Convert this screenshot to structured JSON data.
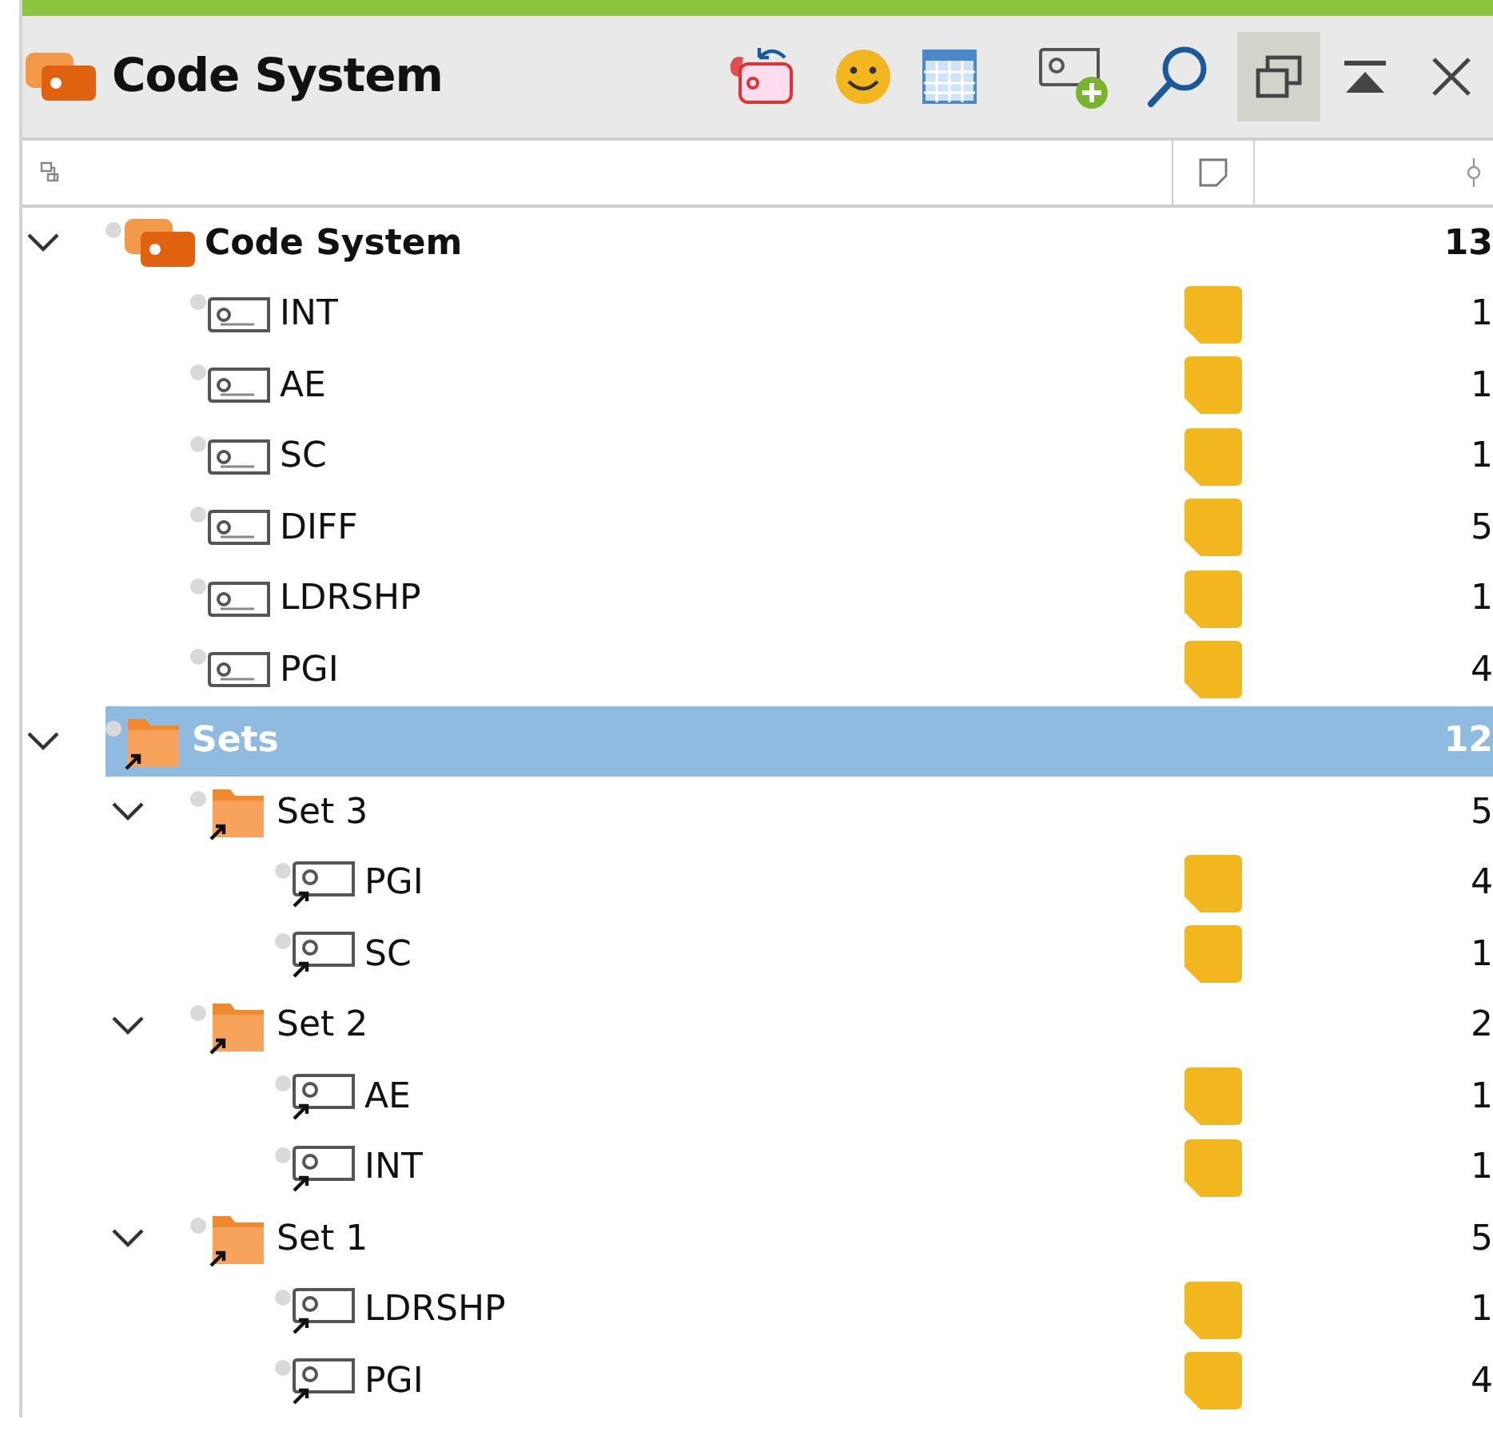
{
  "panel": {
    "title": "Code System"
  },
  "toolbar": [
    {
      "kind": "reset-codes",
      "pressed": false
    },
    {
      "kind": "emoticon",
      "pressed": false
    },
    {
      "kind": "table",
      "pressed": false
    },
    {
      "kind": "new-code",
      "pressed": false
    },
    {
      "kind": "search",
      "pressed": false
    },
    {
      "kind": "undock",
      "pressed": true
    },
    {
      "kind": "collapse",
      "pressed": false
    },
    {
      "kind": "close",
      "pressed": false
    }
  ],
  "tree": [
    {
      "kind": "root",
      "label": "Code System",
      "count": "13",
      "memo": false,
      "selected": false,
      "expanded": true,
      "children": [
        {
          "kind": "code",
          "label": "INT",
          "count": "1",
          "memo": true,
          "selected": false
        },
        {
          "kind": "code",
          "label": "AE",
          "count": "1",
          "memo": true,
          "selected": false
        },
        {
          "kind": "code",
          "label": "SC",
          "count": "1",
          "memo": true,
          "selected": false
        },
        {
          "kind": "code",
          "label": "DIFF",
          "count": "5",
          "memo": true,
          "selected": false
        },
        {
          "kind": "code",
          "label": "LDRSHP",
          "count": "1",
          "memo": true,
          "selected": false
        },
        {
          "kind": "code",
          "label": "PGI",
          "count": "4",
          "memo": true,
          "selected": false
        }
      ]
    },
    {
      "kind": "set-group",
      "label": "Sets",
      "count": "12",
      "memo": false,
      "selected": true,
      "expanded": true,
      "children": [
        {
          "kind": "set",
          "label": "Set 3",
          "count": "5",
          "memo": false,
          "selected": false,
          "expanded": true,
          "children": [
            {
              "kind": "code-link",
              "label": "PGI",
              "count": "4",
              "memo": true,
              "selected": false
            },
            {
              "kind": "code-link",
              "label": "SC",
              "count": "1",
              "memo": true,
              "selected": false
            }
          ]
        },
        {
          "kind": "set",
          "label": "Set 2",
          "count": "2",
          "memo": false,
          "selected": false,
          "expanded": true,
          "children": [
            {
              "kind": "code-link",
              "label": "AE",
              "count": "1",
              "memo": true,
              "selected": false
            },
            {
              "kind": "code-link",
              "label": "INT",
              "count": "1",
              "memo": true,
              "selected": false
            }
          ]
        },
        {
          "kind": "set",
          "label": "Set 1",
          "count": "5",
          "memo": false,
          "selected": false,
          "expanded": true,
          "children": [
            {
              "kind": "code-link",
              "label": "LDRSHP",
              "count": "1",
              "memo": true,
              "selected": false
            },
            {
              "kind": "code-link",
              "label": "PGI",
              "count": "4",
              "memo": true,
              "selected": false
            }
          ]
        }
      ]
    }
  ]
}
